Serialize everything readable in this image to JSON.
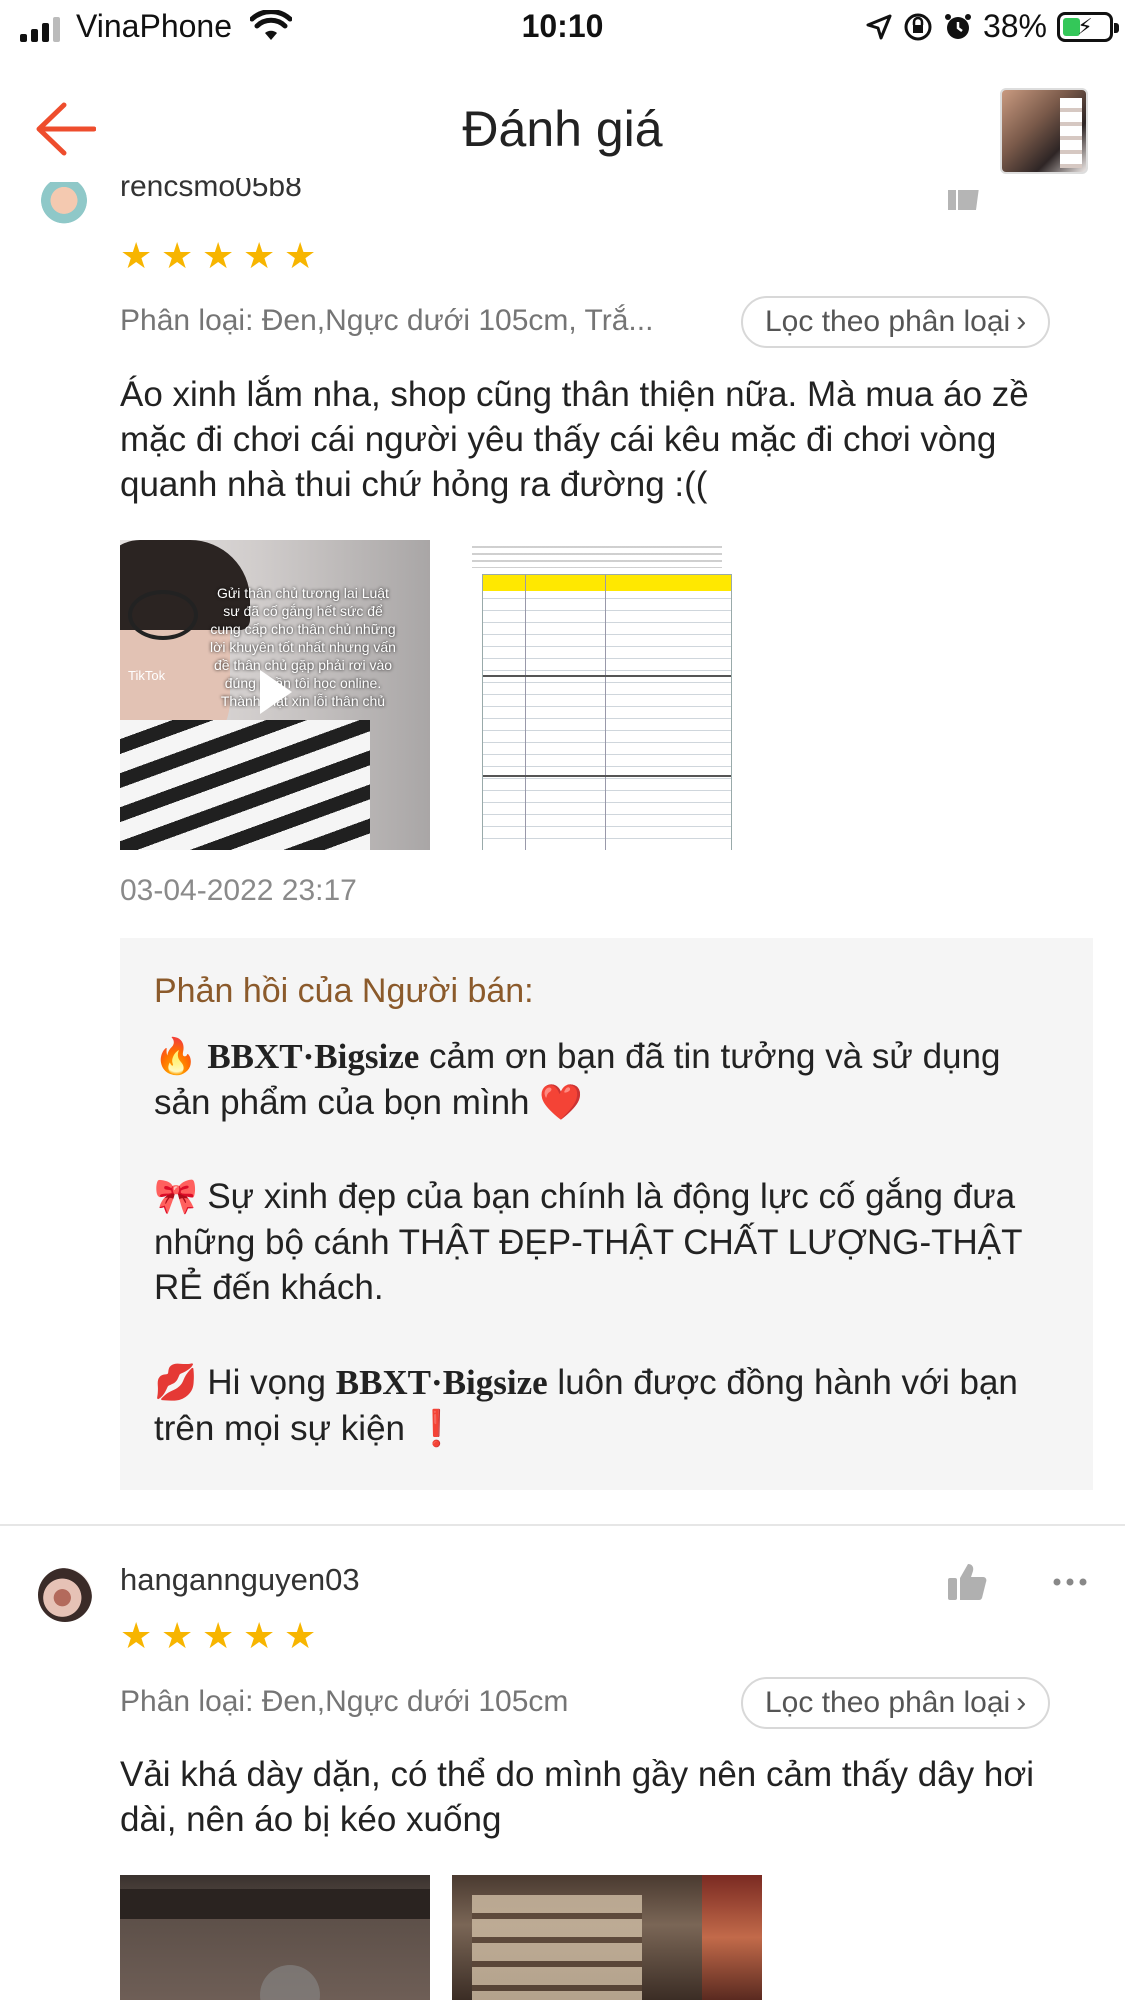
{
  "status_bar": {
    "carrier": "VinaPhone",
    "time": "10:10",
    "battery_percent": "38%",
    "battery_level": 0.38,
    "icons": [
      "signal-icon",
      "wifi-icon",
      "location-icon",
      "orientation-lock-icon",
      "alarm-icon",
      "battery-charging-icon"
    ]
  },
  "header": {
    "title": "Đánh giá",
    "back_icon": "arrow-left-icon",
    "accent_color": "#ee4d2d"
  },
  "reviews": [
    {
      "username_cut": "rencsmo05b8",
      "rating": 5,
      "variant": "Phân loại: Đen,Ngực dưới 105cm, Trắ...",
      "filter_label": "Lọc theo phân loại",
      "comment": "Áo xinh lắm nha, shop cũng thân thiện nữa. Mà mua áo zề mặc đi chơi cái người yêu thấy cái kêu mặc đi chơi vòng quanh nhà thui chứ hỏng ra đường :((",
      "media": [
        {
          "type": "video",
          "caption": "Gửi thân chủ tương lai Luật sư đã cố gắng hết sức để cung cấp cho thân chủ những lời khuyên tốt nhất nhưng vấn đề thân chủ gặp phải rơi vào đúng phần tôi học online. Thành thật xin lỗi thân chủ",
          "watermark": "TikTok"
        },
        {
          "type": "image"
        }
      ],
      "timestamp": "03-04-2022 23:17",
      "seller_reply": {
        "title": "Phản hồi của Người bán:",
        "para1_emoji": "🔥",
        "para1_brand": "BBXT·Bigsize",
        "para1_text": " cảm ơn bạn đã tin tưởng và sử dụng sản phẩm của bọn mình ",
        "para1_end_emoji": "❤️",
        "para2_emoji": "🎀",
        "para2_text": " Sự xinh đẹp của bạn chính là động lực cố gắng đưa những bộ cánh THẬT ĐẸP-THẬT CHẤT LƯỢNG-THẬT RẺ đến khách.",
        "para3_emoji": "💋",
        "para3_pre": " Hi vọng ",
        "para3_brand": "BBXT·Bigsize",
        "para3_text": " luôn được đồng hành với bạn trên mọi sự kiện ",
        "para3_end_emoji": "❗"
      }
    },
    {
      "username": "hangannguyen03",
      "rating": 5,
      "variant": "Phân loại: Đen,Ngực dưới 105cm",
      "filter_label": "Lọc theo phân loại",
      "comment": "Vải khá dày dặn, có thể do mình gầy nên cảm thấy dây hơi dài, nên áo bị kéo xuống",
      "actions": [
        "thumbs-up-icon",
        "more-options-icon"
      ]
    }
  ],
  "colors": {
    "star": "#f7b500",
    "seller_title": "#8b5a2b",
    "seller_bg": "#f5f5f5"
  }
}
